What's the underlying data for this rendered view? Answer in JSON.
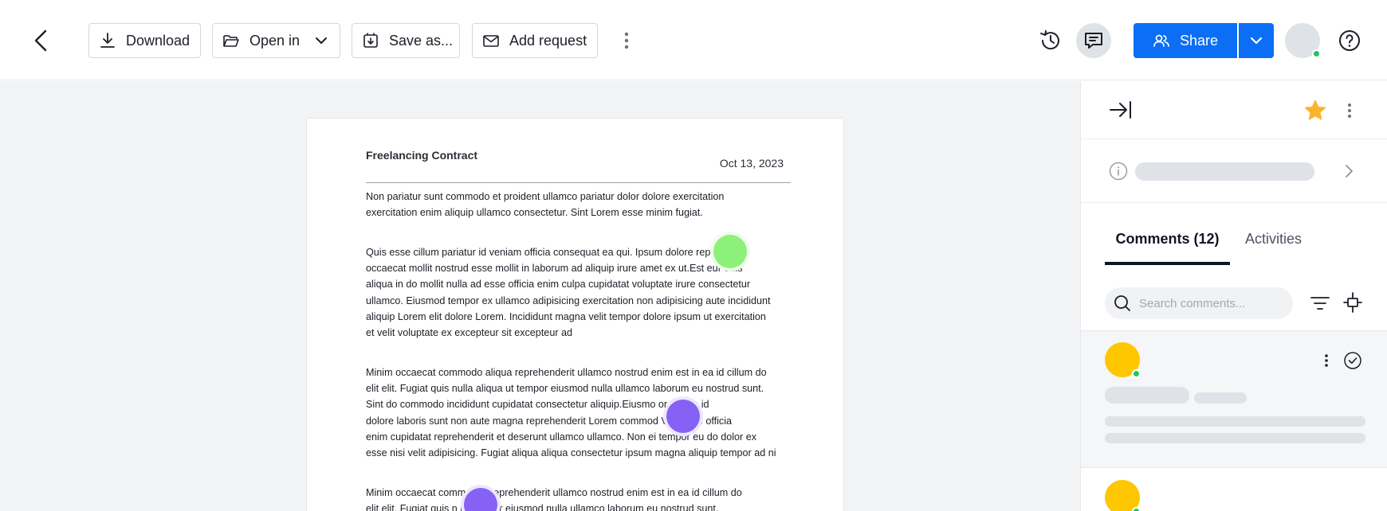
{
  "toolbar": {
    "download_label": "Download",
    "open_in_label": "Open in",
    "save_as_label": "Save as...",
    "add_request_label": "Add request",
    "share_label": "Share"
  },
  "document": {
    "title": "Freelancing Contract",
    "date": "Oct 13, 2023",
    "paragraphs": [
      "Non pariatur sunt commodo et proident ullamco pariatur dolor dolore exercitation\nexercitation enim aliquip ullamco consectetur. Sint Lorem esse minim fugiat.",
      "Quis esse cillum pariatur id veniam officia consequat ea qui. Ipsum dolore rep        it\noccaecat mollit nostrud esse mollit in laborum ad aliquip irure amet ex ut.Est       eur duis\naliqua in do mollit nulla ad esse officia enim culpa cupidatat voluptate irure consectetur\nullamco. Eiusmod tempor ex ullamco adipisicing exercitation non adipisicing aute incididunt\naliquip Lorem elit dolore Lorem. Incididunt magna velit tempor dolore ipsum ut exercitation\net velit voluptate ex excepteur sit excepteur ad",
      "Minim occaecat commodo aliqua reprehenderit ullamco nostrud enim est in ea id cillum do\nelit elit. Fugiat quis nulla aliqua ut tempor eiusmod nulla ullamco laborum eu nostrud sunt.\nSint do commodo incididunt cupidatat consectetur aliquip.Eiusmo          or Lorem id\ndolore laboris sunt non aute magna reprehenderit Lorem commod          Voluptate officia\nenim cupidatat reprehenderit et deserunt ullamco ullamco. Non ei     tempor eu do dolor ex\nesse nisi velit adipisicing. Fugiat aliqua aliqua consectetur ipsum magna aliquip tempor ad ni",
      "Minim occaecat comm          iqua reprehenderit ullamco nostrud enim est in ea id cillum do\nelit elit. Fugiat quis n          ut tempor eiusmod nulla ullamco laborum eu nostrud sunt."
    ]
  },
  "panel": {
    "tabs": {
      "comments_label": "Comments (12)",
      "activities_label": "Activities"
    },
    "search": {
      "placeholder": "Search comments...",
      "value": ""
    }
  },
  "colors": {
    "accent": "#0b6ef5",
    "star": "#fbb42a",
    "online": "#22c55e",
    "comment_avatar": "#ffc700",
    "cursor_green": "#8df07a",
    "cursor_purple": "#8661f5"
  },
  "icons": [
    "chevron-left-icon",
    "download-icon",
    "folder-open-icon",
    "chevron-down-icon",
    "save-as-icon",
    "mail-icon",
    "more-vertical-icon",
    "history-icon",
    "comment-icon",
    "users-icon",
    "help-icon",
    "collapse-panel-icon",
    "star-icon",
    "info-icon",
    "chevron-right-icon",
    "search-icon",
    "filter-icon",
    "sort-icon",
    "check-circle-icon"
  ]
}
